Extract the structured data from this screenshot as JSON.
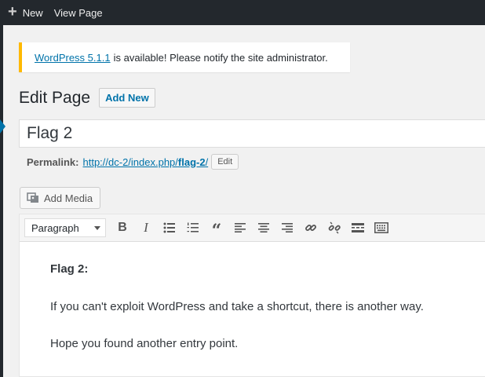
{
  "adminbar": {
    "new_label": "New",
    "view_page_label": "View Page"
  },
  "notice": {
    "link_text": "WordPress 5.1.1",
    "message": "is available! Please notify the site administrator."
  },
  "heading": {
    "title": "Edit Page",
    "add_new_label": "Add New"
  },
  "post_title": {
    "value": "Flag 2"
  },
  "permalink": {
    "label": "Permalink:",
    "url_base": "http://dc-2/index.php/",
    "slug": "flag-2",
    "url_end": "/",
    "edit_label": "Edit"
  },
  "media": {
    "add_media_label": "Add Media"
  },
  "toolbar": {
    "format_selected": "Paragraph",
    "buttons": [
      "bold-icon",
      "italic-icon",
      "bullet-list-icon",
      "numbered-list-icon",
      "blockquote-icon",
      "align-left-icon",
      "align-center-icon",
      "align-right-icon",
      "link-icon",
      "unlink-icon",
      "read-more-icon",
      "toolbar-toggle-icon"
    ]
  },
  "content": {
    "heading": "Flag 2:",
    "paragraph1": "If you can't exploit WordPress and take a shortcut, there is another way.",
    "paragraph2": "Hope you found another entry point."
  },
  "colors": {
    "adminbar_bg": "#23282d",
    "link": "#0073aa",
    "notice_border": "#ffb900"
  }
}
